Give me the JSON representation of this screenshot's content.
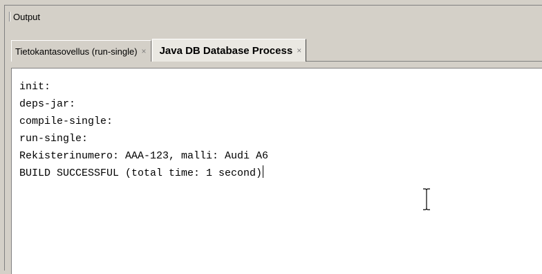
{
  "panel": {
    "title": "Output"
  },
  "tabs": [
    {
      "label": "Tietokantasovellus (run-single)",
      "close": "×",
      "active": false
    },
    {
      "label": "Java DB Database Process",
      "close": "×",
      "active": true
    }
  ],
  "output": {
    "lines": [
      "init:",
      "deps-jar:",
      "compile-single:",
      "run-single:",
      "Rekisterinumero: AAA-123, malli: Audi A6",
      "BUILD SUCCESSFUL (total time: 1 second)"
    ]
  },
  "icons": {
    "title_grip": "grip-icon",
    "tab_close": "close-icon",
    "mouse_cursor": "ibeam-cursor-icon"
  }
}
